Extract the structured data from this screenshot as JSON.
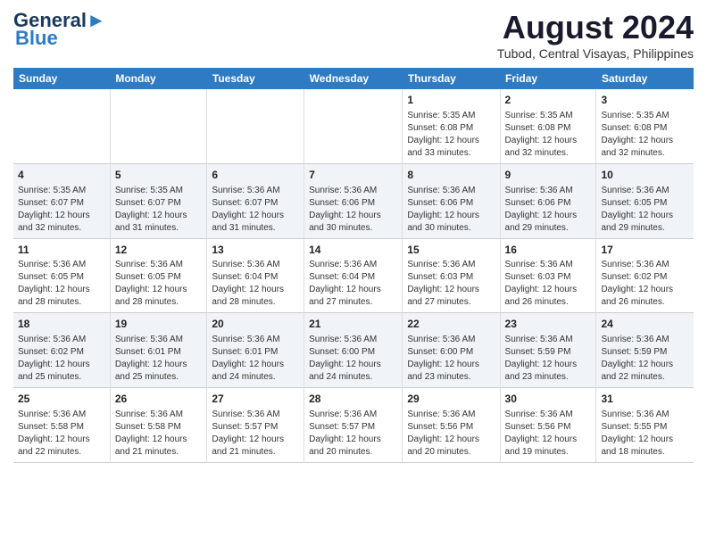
{
  "header": {
    "logo_general": "General",
    "logo_blue": "Blue",
    "month_title": "August 2024",
    "location": "Tubod, Central Visayas, Philippines"
  },
  "days_of_week": [
    "Sunday",
    "Monday",
    "Tuesday",
    "Wednesday",
    "Thursday",
    "Friday",
    "Saturday"
  ],
  "weeks": [
    [
      {
        "day": "",
        "content": ""
      },
      {
        "day": "",
        "content": ""
      },
      {
        "day": "",
        "content": ""
      },
      {
        "day": "",
        "content": ""
      },
      {
        "day": "1",
        "content": "Sunrise: 5:35 AM\nSunset: 6:08 PM\nDaylight: 12 hours\nand 33 minutes."
      },
      {
        "day": "2",
        "content": "Sunrise: 5:35 AM\nSunset: 6:08 PM\nDaylight: 12 hours\nand 32 minutes."
      },
      {
        "day": "3",
        "content": "Sunrise: 5:35 AM\nSunset: 6:08 PM\nDaylight: 12 hours\nand 32 minutes."
      }
    ],
    [
      {
        "day": "4",
        "content": "Sunrise: 5:35 AM\nSunset: 6:07 PM\nDaylight: 12 hours\nand 32 minutes."
      },
      {
        "day": "5",
        "content": "Sunrise: 5:35 AM\nSunset: 6:07 PM\nDaylight: 12 hours\nand 31 minutes."
      },
      {
        "day": "6",
        "content": "Sunrise: 5:36 AM\nSunset: 6:07 PM\nDaylight: 12 hours\nand 31 minutes."
      },
      {
        "day": "7",
        "content": "Sunrise: 5:36 AM\nSunset: 6:06 PM\nDaylight: 12 hours\nand 30 minutes."
      },
      {
        "day": "8",
        "content": "Sunrise: 5:36 AM\nSunset: 6:06 PM\nDaylight: 12 hours\nand 30 minutes."
      },
      {
        "day": "9",
        "content": "Sunrise: 5:36 AM\nSunset: 6:06 PM\nDaylight: 12 hours\nand 29 minutes."
      },
      {
        "day": "10",
        "content": "Sunrise: 5:36 AM\nSunset: 6:05 PM\nDaylight: 12 hours\nand 29 minutes."
      }
    ],
    [
      {
        "day": "11",
        "content": "Sunrise: 5:36 AM\nSunset: 6:05 PM\nDaylight: 12 hours\nand 28 minutes."
      },
      {
        "day": "12",
        "content": "Sunrise: 5:36 AM\nSunset: 6:05 PM\nDaylight: 12 hours\nand 28 minutes."
      },
      {
        "day": "13",
        "content": "Sunrise: 5:36 AM\nSunset: 6:04 PM\nDaylight: 12 hours\nand 28 minutes."
      },
      {
        "day": "14",
        "content": "Sunrise: 5:36 AM\nSunset: 6:04 PM\nDaylight: 12 hours\nand 27 minutes."
      },
      {
        "day": "15",
        "content": "Sunrise: 5:36 AM\nSunset: 6:03 PM\nDaylight: 12 hours\nand 27 minutes."
      },
      {
        "day": "16",
        "content": "Sunrise: 5:36 AM\nSunset: 6:03 PM\nDaylight: 12 hours\nand 26 minutes."
      },
      {
        "day": "17",
        "content": "Sunrise: 5:36 AM\nSunset: 6:02 PM\nDaylight: 12 hours\nand 26 minutes."
      }
    ],
    [
      {
        "day": "18",
        "content": "Sunrise: 5:36 AM\nSunset: 6:02 PM\nDaylight: 12 hours\nand 25 minutes."
      },
      {
        "day": "19",
        "content": "Sunrise: 5:36 AM\nSunset: 6:01 PM\nDaylight: 12 hours\nand 25 minutes."
      },
      {
        "day": "20",
        "content": "Sunrise: 5:36 AM\nSunset: 6:01 PM\nDaylight: 12 hours\nand 24 minutes."
      },
      {
        "day": "21",
        "content": "Sunrise: 5:36 AM\nSunset: 6:00 PM\nDaylight: 12 hours\nand 24 minutes."
      },
      {
        "day": "22",
        "content": "Sunrise: 5:36 AM\nSunset: 6:00 PM\nDaylight: 12 hours\nand 23 minutes."
      },
      {
        "day": "23",
        "content": "Sunrise: 5:36 AM\nSunset: 5:59 PM\nDaylight: 12 hours\nand 23 minutes."
      },
      {
        "day": "24",
        "content": "Sunrise: 5:36 AM\nSunset: 5:59 PM\nDaylight: 12 hours\nand 22 minutes."
      }
    ],
    [
      {
        "day": "25",
        "content": "Sunrise: 5:36 AM\nSunset: 5:58 PM\nDaylight: 12 hours\nand 22 minutes."
      },
      {
        "day": "26",
        "content": "Sunrise: 5:36 AM\nSunset: 5:58 PM\nDaylight: 12 hours\nand 21 minutes."
      },
      {
        "day": "27",
        "content": "Sunrise: 5:36 AM\nSunset: 5:57 PM\nDaylight: 12 hours\nand 21 minutes."
      },
      {
        "day": "28",
        "content": "Sunrise: 5:36 AM\nSunset: 5:57 PM\nDaylight: 12 hours\nand 20 minutes."
      },
      {
        "day": "29",
        "content": "Sunrise: 5:36 AM\nSunset: 5:56 PM\nDaylight: 12 hours\nand 20 minutes."
      },
      {
        "day": "30",
        "content": "Sunrise: 5:36 AM\nSunset: 5:56 PM\nDaylight: 12 hours\nand 19 minutes."
      },
      {
        "day": "31",
        "content": "Sunrise: 5:36 AM\nSunset: 5:55 PM\nDaylight: 12 hours\nand 18 minutes."
      }
    ]
  ]
}
